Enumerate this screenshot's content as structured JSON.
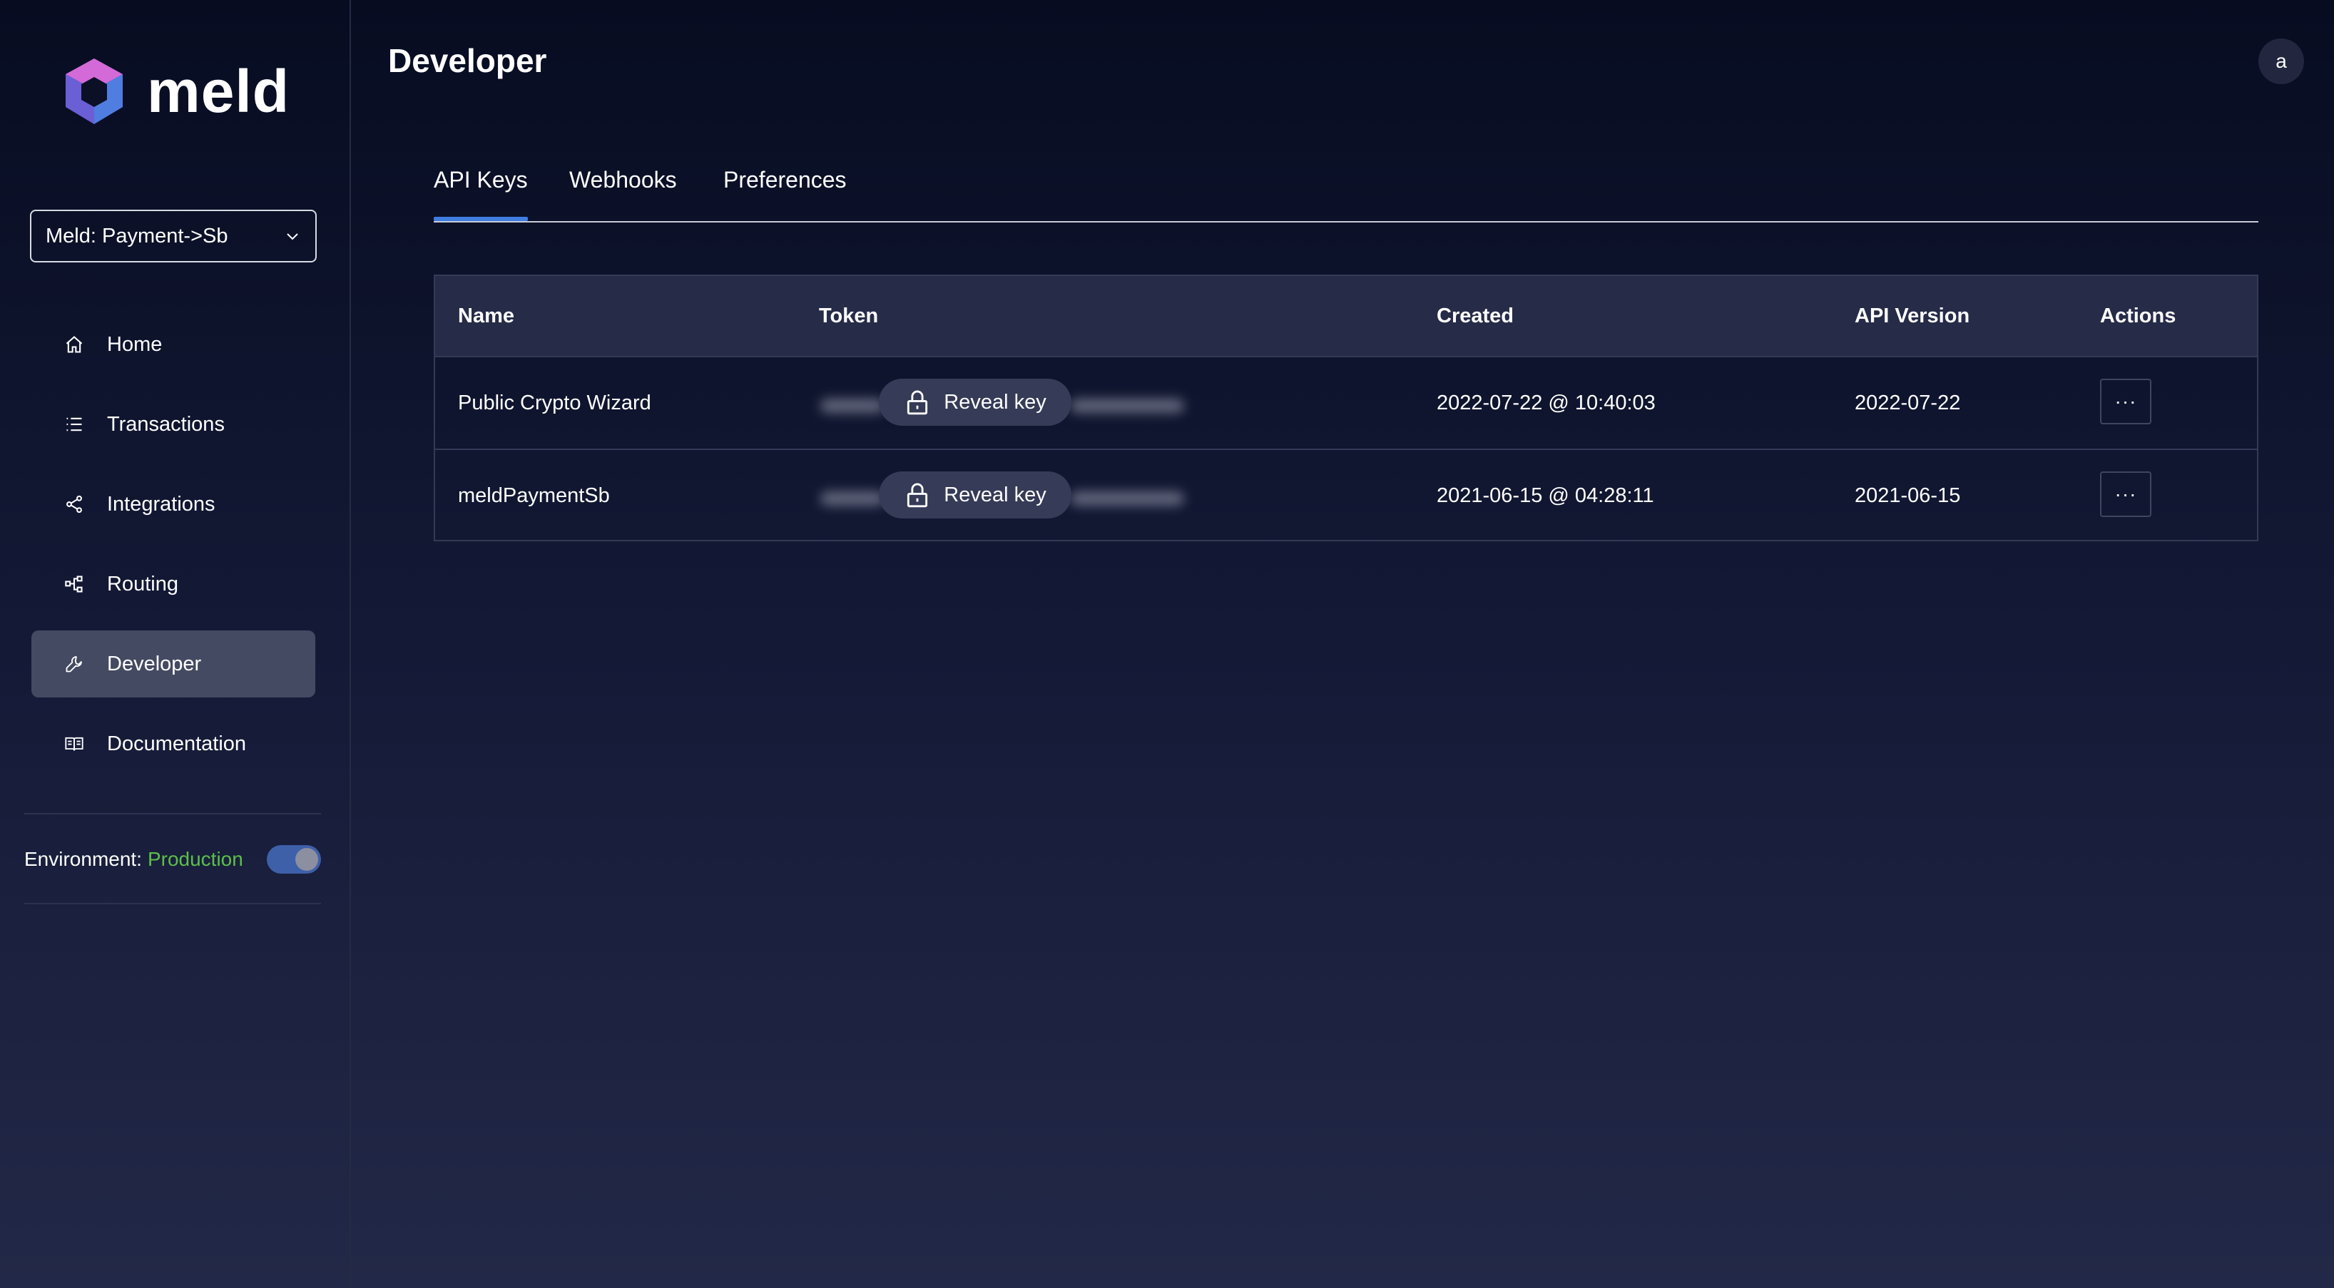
{
  "brand": {
    "name": "meld"
  },
  "org_selector": {
    "value": "Meld: Payment->Sb"
  },
  "nav": [
    {
      "label": "Home",
      "icon": "home-icon",
      "active": false
    },
    {
      "label": "Transactions",
      "icon": "list-icon",
      "active": false
    },
    {
      "label": "Integrations",
      "icon": "share-icon",
      "active": false
    },
    {
      "label": "Routing",
      "icon": "routing-icon",
      "active": false
    },
    {
      "label": "Developer",
      "icon": "wrench-icon",
      "active": true
    },
    {
      "label": "Documentation",
      "icon": "book-icon",
      "active": false
    }
  ],
  "environment": {
    "label": "Environment:",
    "value": "Production",
    "value_color": "#5cbf4a",
    "toggle_on": true
  },
  "header": {
    "title": "Developer",
    "avatar_initial": "a"
  },
  "tabs": [
    {
      "label": "API Keys",
      "active": true
    },
    {
      "label": "Webhooks",
      "active": false
    },
    {
      "label": "Preferences",
      "active": false
    }
  ],
  "table": {
    "headers": [
      "Name",
      "Token",
      "Created",
      "API Version",
      "Actions"
    ],
    "reveal_label": "Reveal key",
    "actions_label": "···",
    "rows": [
      {
        "name": "Public Crypto Wizard",
        "created": "2022-07-22 @ 10:40:03",
        "api_version": "2022-07-22"
      },
      {
        "name": "meldPaymentSb",
        "created": "2021-06-15 @ 04:28:11",
        "api_version": "2021-06-15"
      }
    ]
  },
  "colors": {
    "accent": "#3f7de0",
    "active_nav": "#444a61",
    "table_header": "#262b48"
  }
}
